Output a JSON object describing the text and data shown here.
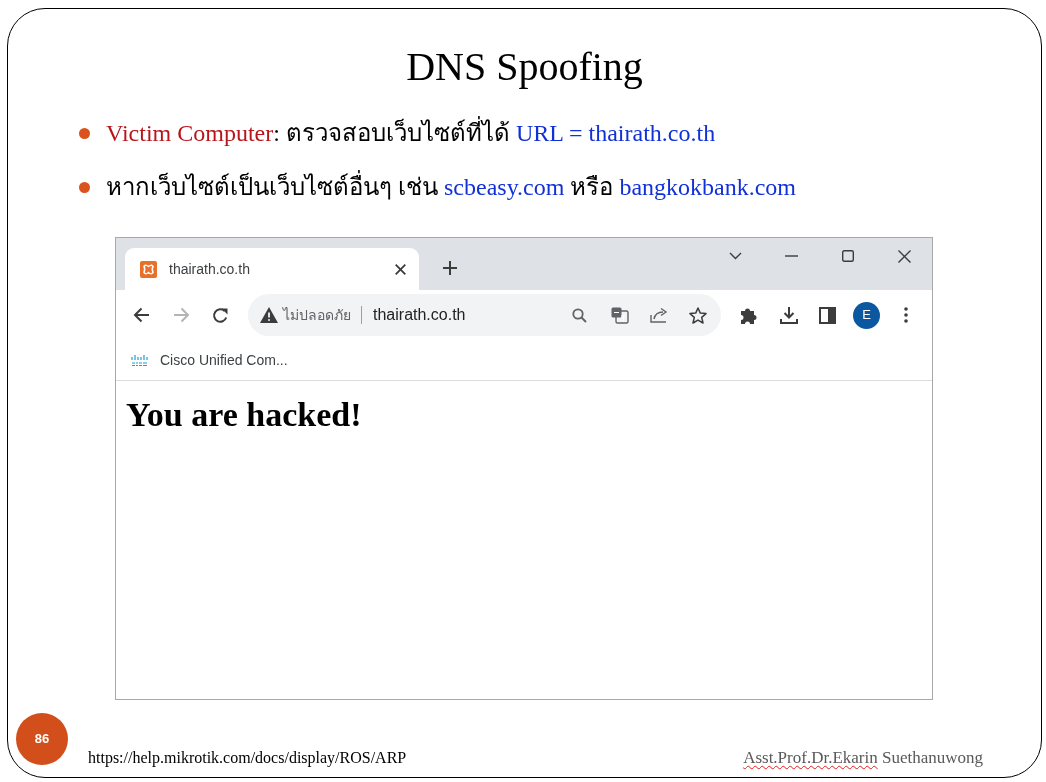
{
  "slide": {
    "title": "DNS Spoofing",
    "bullets": [
      {
        "segments": [
          {
            "kind": "term",
            "text": "Victim Computer"
          },
          {
            "kind": "plain",
            "text": ": ตรวจสอบเว็บไซต์ที่ได้ "
          },
          {
            "kind": "link",
            "text": "URL = thairath.co.th"
          }
        ]
      },
      {
        "segments": [
          {
            "kind": "plain",
            "text": "หากเว็บไซต์เป็นเว็บไซต์อื่นๆ เช่น "
          },
          {
            "kind": "link",
            "text": "scbeasy.com"
          },
          {
            "kind": "plain",
            "text": " หรือ "
          },
          {
            "kind": "link",
            "text": "bangkokbank.com"
          }
        ]
      }
    ],
    "browser": {
      "tabs": [
        {
          "title": "thairath.co.th",
          "selected": true
        }
      ],
      "address_bar": {
        "security_label": "ไม่ปลอดภัย",
        "url": "thairath.co.th"
      },
      "profile_initial": "E",
      "bookmarks": [
        {
          "label": "Cisco Unified Com..."
        }
      ],
      "page_heading": "You are hacked!"
    },
    "page_number": "86",
    "source_url": "https://help.mikrotik.com/docs/display/ROS/ARP",
    "author": [
      {
        "text": "Asst.Prof.Dr.Ekarin",
        "spellcheck_flag": true
      },
      {
        "text": "Suethanuwong",
        "spellcheck_flag": false
      }
    ]
  }
}
